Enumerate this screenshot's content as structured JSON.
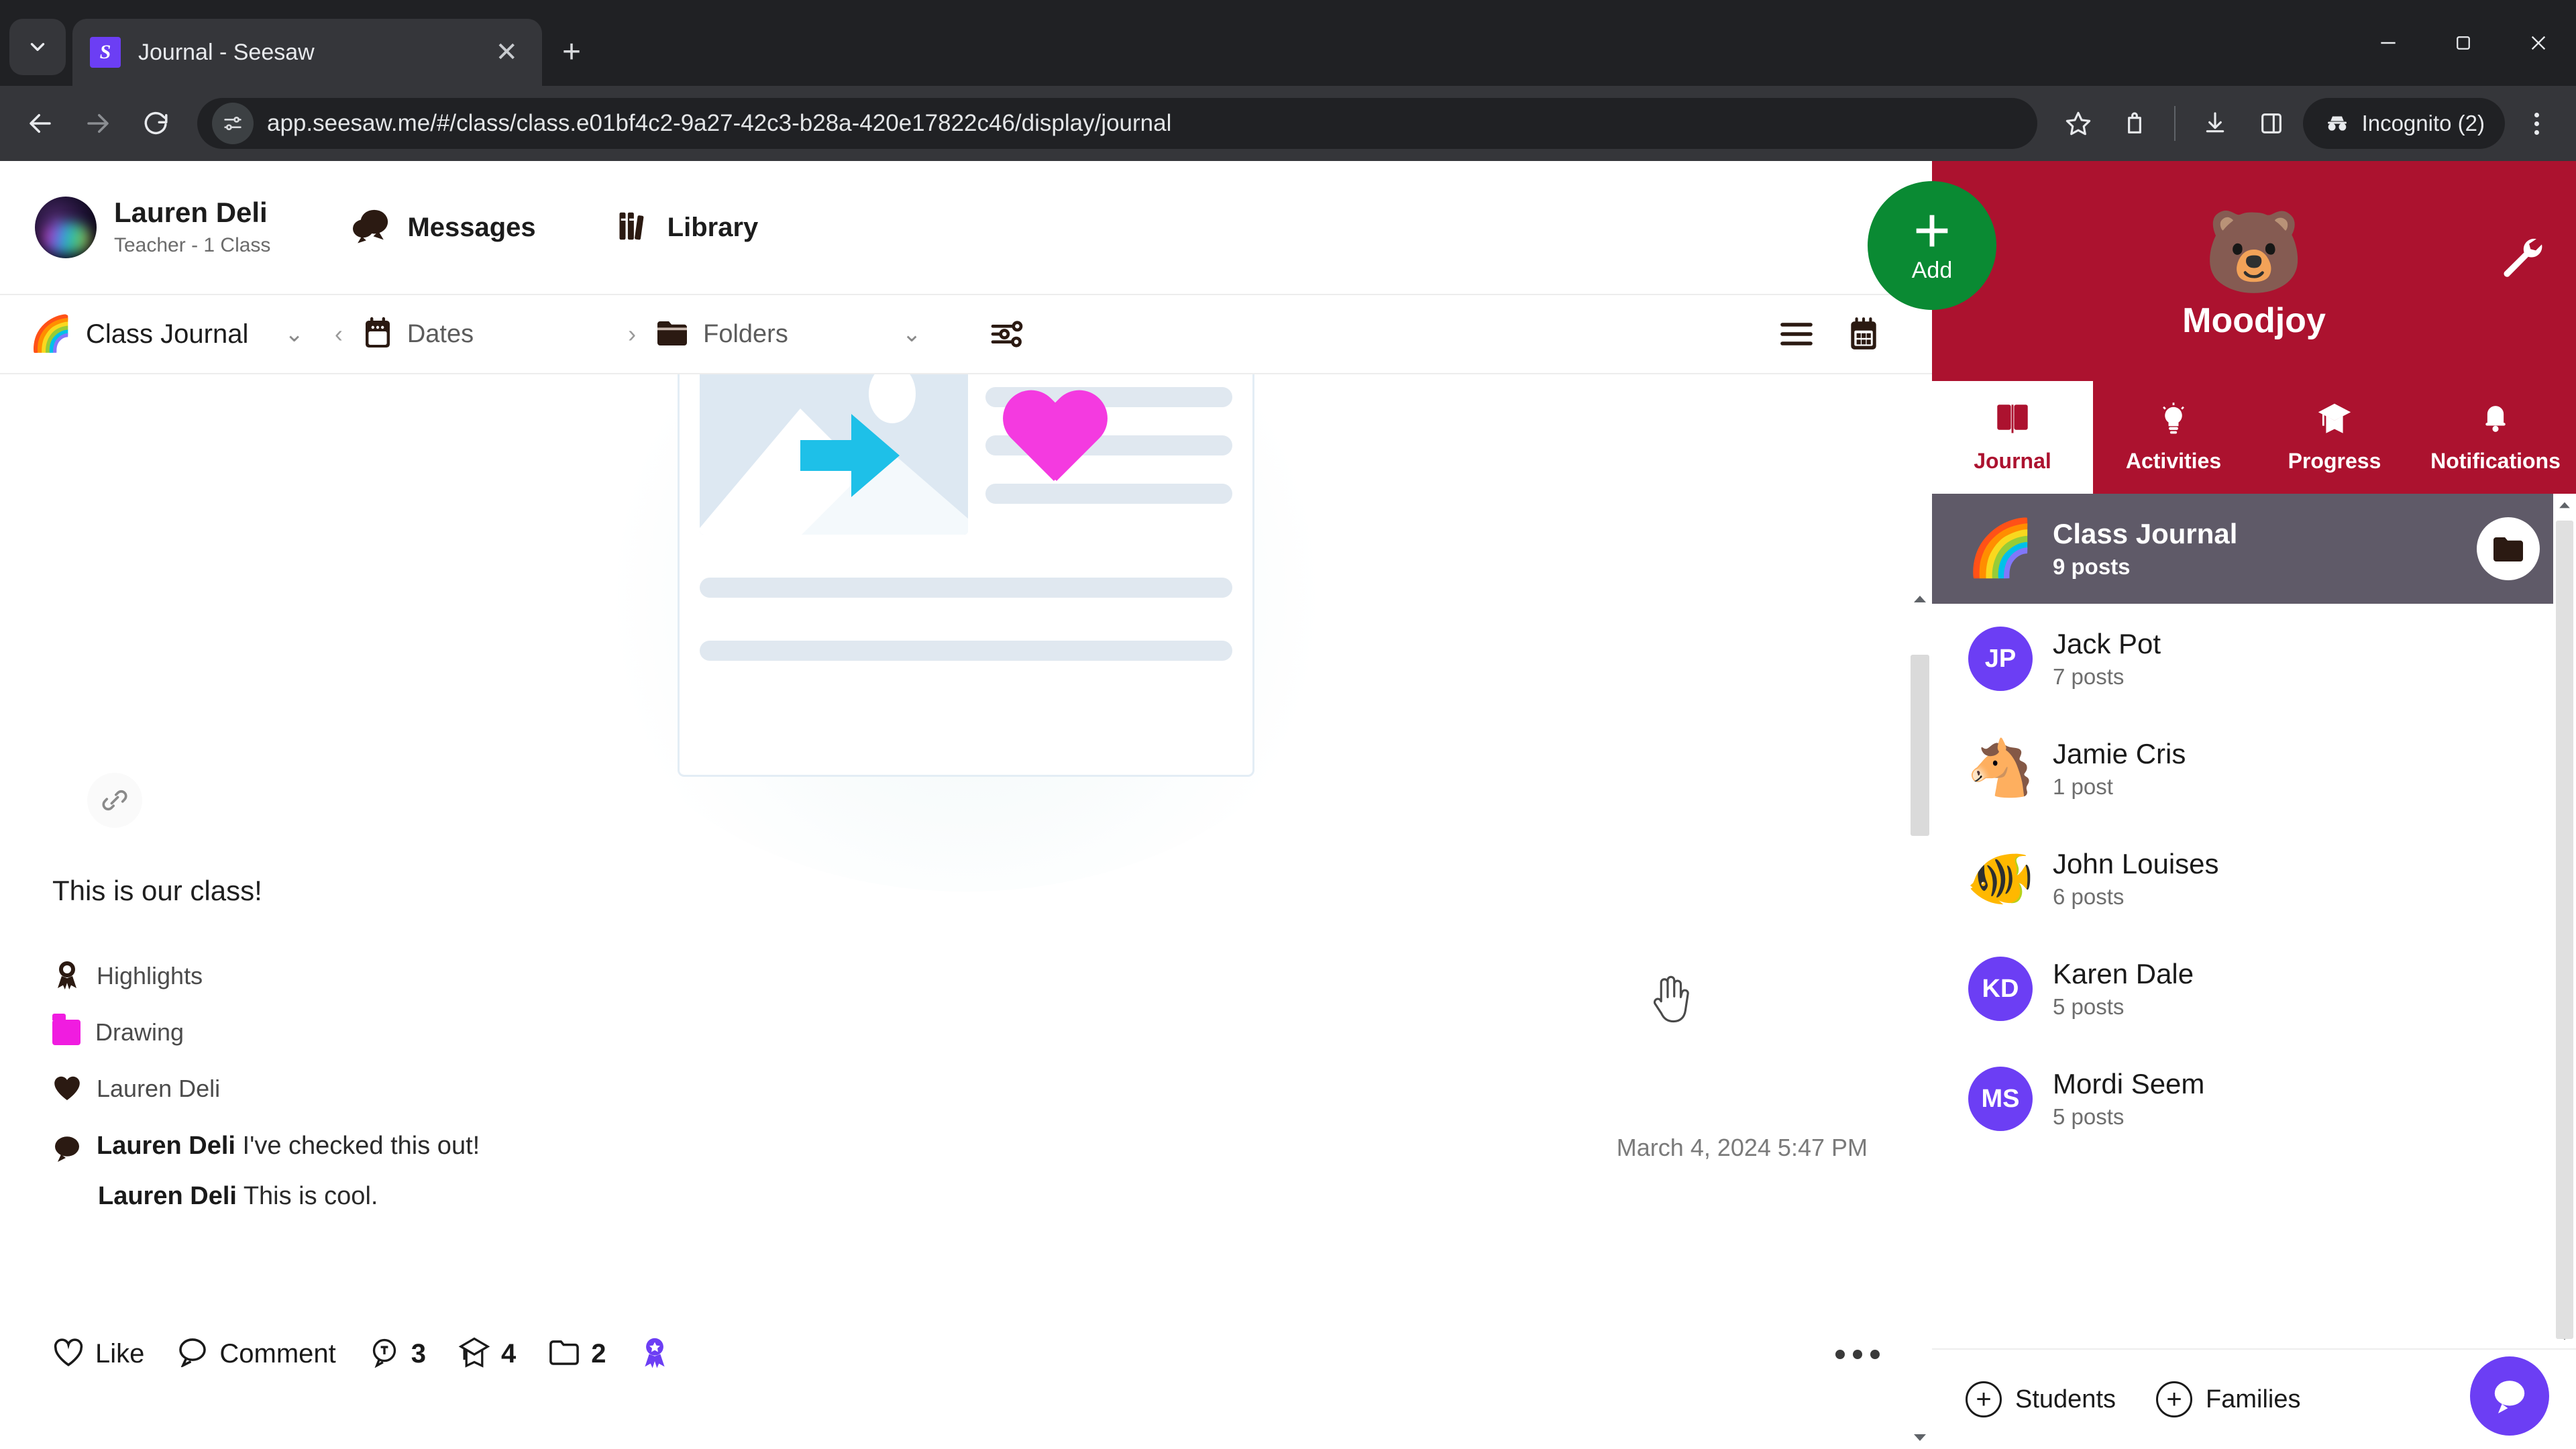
{
  "browser": {
    "tab": {
      "title": "Journal - Seesaw",
      "favicon_letter": "S"
    },
    "url": "app.seesaw.me/#/class/class.e01bf4c2-9a27-42c3-b28a-420e17822c46/display/journal",
    "profile_label": "Incognito (2)",
    "icons": {
      "tab_list": "chevron-down-icon",
      "close_tab": "close-icon",
      "new_tab": "plus-icon",
      "back": "back-arrow-icon",
      "forward": "forward-arrow-icon",
      "reload": "reload-icon",
      "site_info": "site-settings-icon",
      "bookmark": "star-icon",
      "extensions": "extensions-icon",
      "downloads": "download-icon",
      "side_panel": "side-panel-icon",
      "incognito": "incognito-icon",
      "menu": "kebab-menu-icon",
      "minimize": "minimize-icon",
      "maximize": "maximize-icon",
      "close_window": "close-window-icon"
    }
  },
  "app_header": {
    "user_name": "Lauren Deli",
    "user_role": "Teacher - 1 Class",
    "messages_label": "Messages",
    "library_label": "Library"
  },
  "subbar": {
    "journal_emoji": "🌈",
    "journal_title": "Class Journal",
    "dates_label": "Dates",
    "folders_label": "Folders",
    "filter_icon": "filter-sliders-icon",
    "list_view_icon": "list-view-icon",
    "calendar_view_icon": "calendar-view-icon"
  },
  "post": {
    "caption": "This is our class!",
    "date": "March 4, 2024 5:47 PM",
    "meta": [
      {
        "icon": "award-ribbon-icon",
        "label": "Highlights"
      },
      {
        "icon": "folder-icon",
        "label": "Drawing",
        "color": "#f01ce0"
      },
      {
        "icon": "heart-filled-icon",
        "label": "Lauren Deli"
      }
    ],
    "comments": [
      {
        "author": "Lauren Deli",
        "text": "I've checked this out!"
      },
      {
        "author": "Lauren Deli",
        "text": "This is cool."
      }
    ],
    "actions": {
      "like_label": "Like",
      "comment_label": "Comment",
      "text_comment_count": "3",
      "progress_count": "4",
      "folder_count": "2"
    }
  },
  "sidebar": {
    "class_emoji": "🐻",
    "class_name": "Moodjoy",
    "add_label": "Add",
    "tabs": [
      {
        "label": "Journal",
        "icon": "book-icon",
        "active": true
      },
      {
        "label": "Activities",
        "icon": "lightbulb-icon",
        "active": false
      },
      {
        "label": "Progress",
        "icon": "graduation-cap-icon",
        "active": false
      },
      {
        "label": "Notifications",
        "icon": "bell-icon",
        "active": false
      }
    ],
    "roster": [
      {
        "name": "Class Journal",
        "posts": "9 posts",
        "avatar_type": "emoji",
        "avatar": "🌈",
        "selected": true,
        "badge": "folder-icon"
      },
      {
        "name": "Jack Pot",
        "posts": "7 posts",
        "avatar_type": "initials",
        "avatar": "JP",
        "color": "#6c3ef4",
        "selected": false
      },
      {
        "name": "Jamie Cris",
        "posts": "1 post",
        "avatar_type": "emoji",
        "avatar": "🐴",
        "selected": false
      },
      {
        "name": "John Louises",
        "posts": "6 posts",
        "avatar_type": "emoji",
        "avatar": "🐠",
        "selected": false
      },
      {
        "name": "Karen Dale",
        "posts": "5 posts",
        "avatar_type": "initials",
        "avatar": "KD",
        "color": "#6c3ef4",
        "selected": false
      },
      {
        "name": "Mordi Seem",
        "posts": "5 posts",
        "avatar_type": "initials",
        "avatar": "MS",
        "color": "#6c3ef4",
        "selected": false
      }
    ],
    "footer": {
      "students_label": "Students",
      "families_label": "Families",
      "chat_icon": "chat-bubble-icon"
    }
  },
  "colors": {
    "brand_red": "#ac122f",
    "add_green": "#0a8a33",
    "purple": "#6c3ef4",
    "folder_pink": "#f01ce0"
  }
}
